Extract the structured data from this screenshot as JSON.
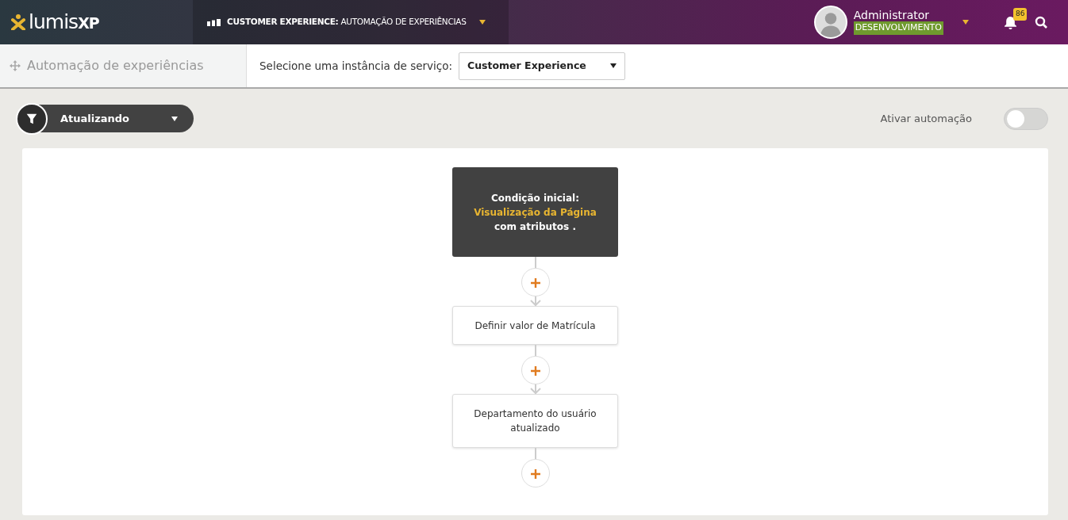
{
  "header": {
    "logo": "lumis**XP**",
    "menu": "**CUSTOMER EXPERIENCE:** AUTOMAÇÃO DE EXPERIÊNCIAS",
    "user": {
      "name": "Administrator",
      "environment": "DESENVOLVIMENTO"
    },
    "notifications": "86"
  },
  "toolbar": {
    "title": "Automação de experiências",
    "instance_label": "Selecione uma instância de serviço:",
    "instance_value": "Customer Experience"
  },
  "filter": {
    "value": "Atualizando"
  },
  "automation_toggle": {
    "label": "Ativar automação",
    "on": false
  },
  "flow": {
    "nodes": [
      {
        "kind": "trigger",
        "label": "Condição inicial:",
        "event": "Visualização da Página",
        "suffix": "com atributos ."
      },
      {
        "kind": "action",
        "text": "Definir valor de Matrícula"
      },
      {
        "kind": "action",
        "text": "Departamento do usuário atualizado"
      }
    ]
  }
}
